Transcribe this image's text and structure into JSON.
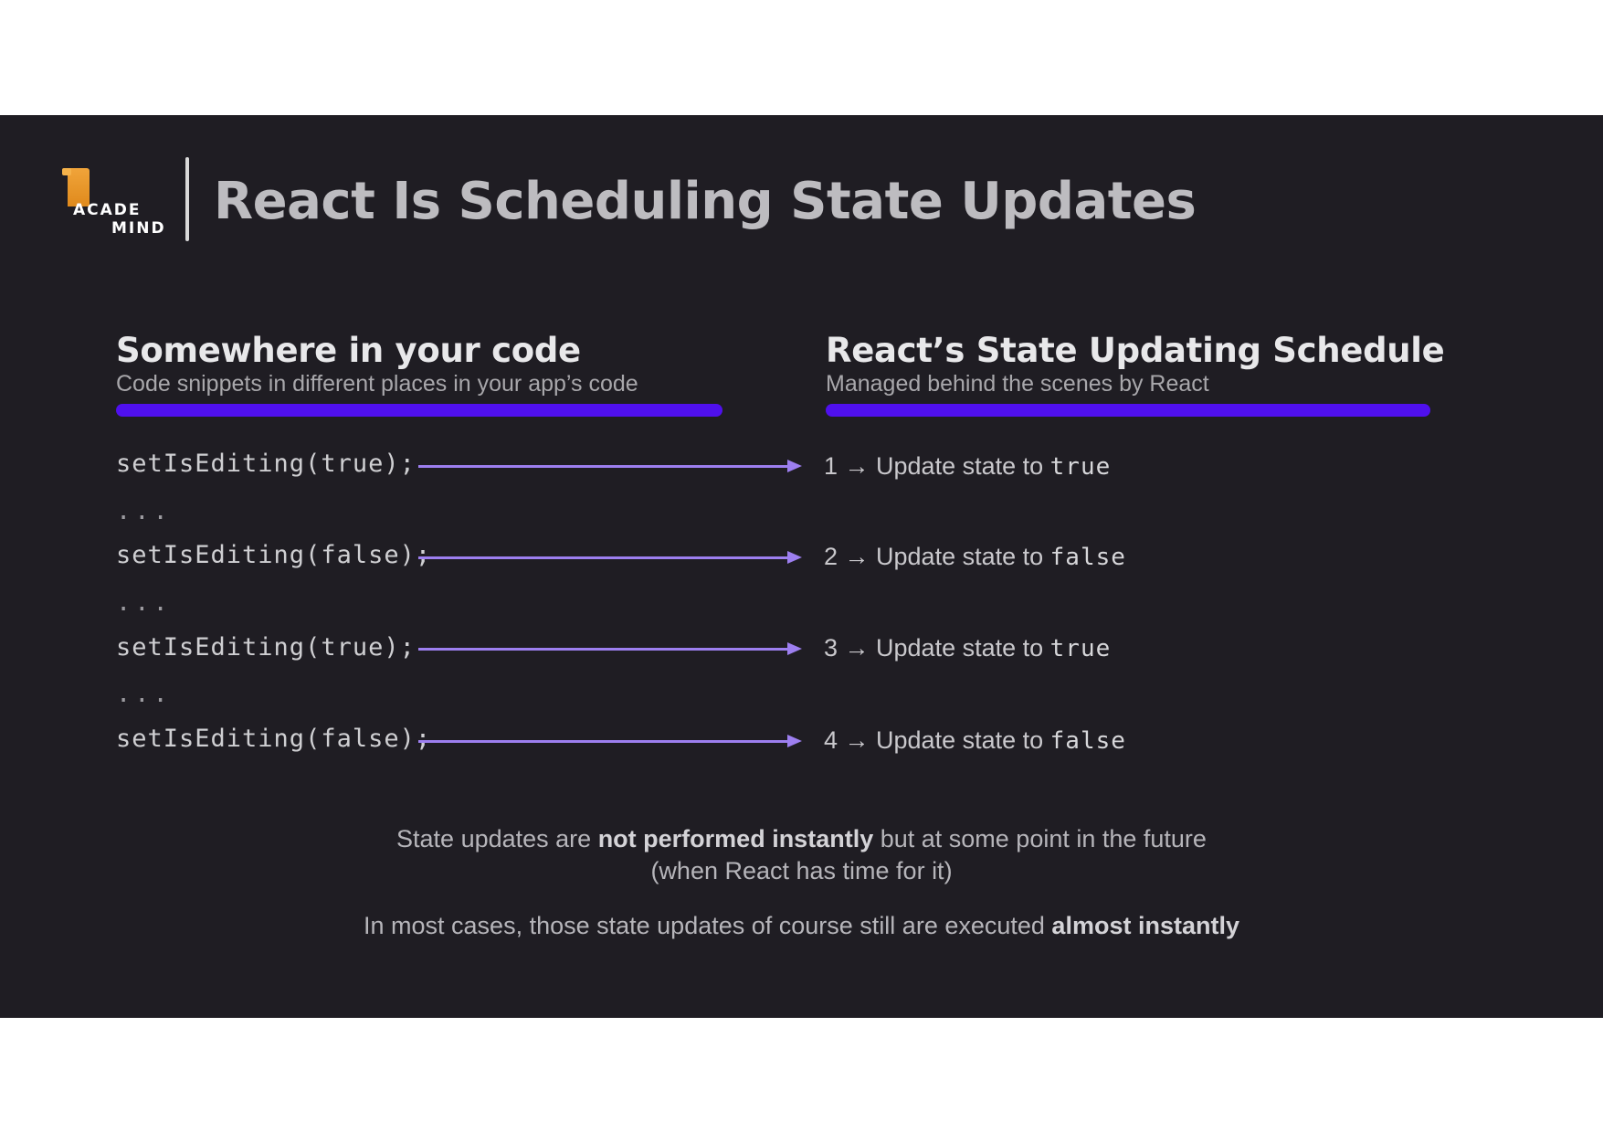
{
  "header": {
    "logo_line1": "ACADE",
    "logo_line2": "MIND",
    "title": "React Is Scheduling State Updates"
  },
  "left_column": {
    "heading": "Somewhere in your code",
    "subheading": "Code snippets in different places in your app’s code"
  },
  "right_column": {
    "heading": "React’s State Updating Schedule",
    "subheading": "Managed behind the scenes by React"
  },
  "code_lines": [
    "setIsEditing(true);",
    "setIsEditing(false);",
    "setIsEditing(true);",
    "setIsEditing(false);"
  ],
  "ellipsis": "...",
  "schedule": [
    {
      "prefix": "1 → Update state to ",
      "value": "true"
    },
    {
      "prefix": "2 → Update state to ",
      "value": "false"
    },
    {
      "prefix": "3 → Update state to ",
      "value": "true"
    },
    {
      "prefix": "4 → Update state to ",
      "value": "false"
    }
  ],
  "notes": {
    "line1_a": "State updates are ",
    "line1_bold": "not performed instantly",
    "line1_b": " but at some point in the future",
    "line2": "(when React has time for it)",
    "line3_a": "In most cases, those state updates of course still are executed ",
    "line3_bold": "almost instantly"
  },
  "colors": {
    "background": "#1f1d23",
    "underline": "#4f10ee",
    "arrow": "#9d7ff0",
    "logo_orange": "#e08a1c"
  }
}
